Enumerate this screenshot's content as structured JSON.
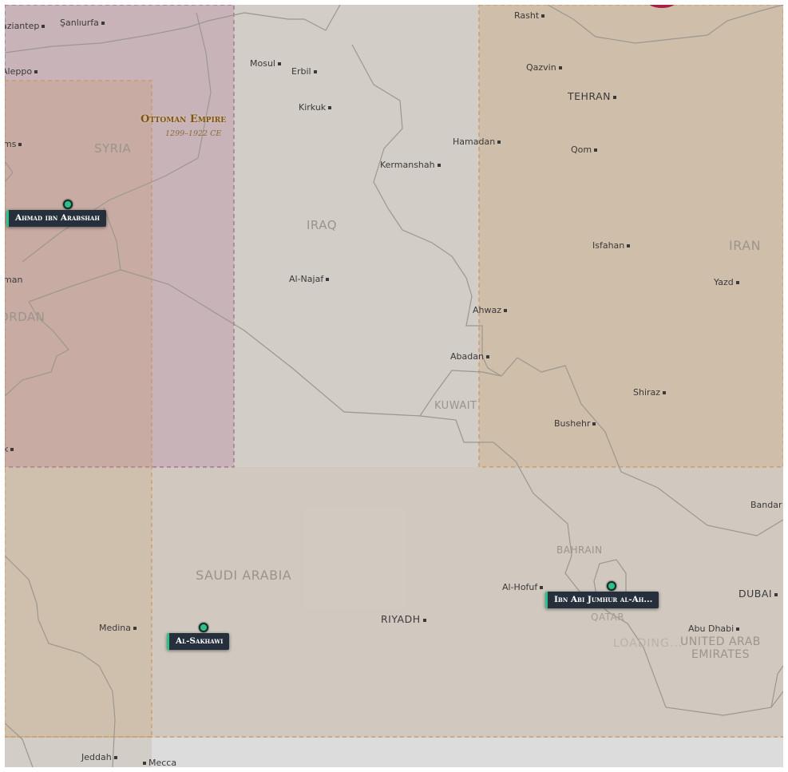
{
  "empires": [
    {
      "name": "Ottoman Empire",
      "dates": "1299–1922 CE",
      "color": "#b98fa8"
    },
    {
      "name": "",
      "color": "#c99a6a"
    }
  ],
  "countries": {
    "syria": "SYRIA",
    "iraq": "IRAQ",
    "iran": "IRAN",
    "jordan": "JORDAN",
    "kuwait": "KUWAIT",
    "saudi_arabia": "SAUDI ARABIA",
    "bahrain": "BAHRAIN",
    "qatar": "QATAR",
    "uae": "UNITED ARAB EMIRATES",
    "uae_line1": "UNITED ARAB",
    "uae_line2": "EMIRATES"
  },
  "cities": [
    "Gaziantep",
    "Şanlıurfa",
    "Aleppo",
    "Homs",
    "Amman",
    "Mosul",
    "Erbil",
    "Kirkuk",
    "Hamadan",
    "Kermanshah",
    "Al-Najaf",
    "Rasht",
    "Qazvin",
    "TEHRAN",
    "Qom",
    "Isfahan",
    "Yazd",
    "Ahwaz",
    "Abadan",
    "Shiraz",
    "Bushehr",
    "Bandar",
    "Al-Hofuf",
    "RIYADH",
    "DUBAI",
    "Abu Dhabi",
    "Medina",
    "Jeddah",
    "Mecca",
    "Tabuk"
  ],
  "city_labels": {
    "gaziantep": "aziantep",
    "sanliurfa": "Şanlıurfa",
    "aleppo": "Aleppo",
    "homs": "ms",
    "amman": "man",
    "mosul": "Mosul",
    "erbil": "Erbil",
    "kirkuk": "Kirkuk",
    "hamadan": "Hamadan",
    "kermanshah": "Kermanshah",
    "al_najaf": "Al-Najaf",
    "rasht": "Rasht",
    "qazvin": "Qazvin",
    "tehran": "TEHRAN",
    "qom": "Qom",
    "isfahan": "Isfahan",
    "yazd": "Yazd",
    "ahwaz": "Ahwaz",
    "abadan": "Abadan",
    "shiraz": "Shiraz",
    "bushehr": "Bushehr",
    "bandar": "Bandar",
    "al_hofuf": "Al-Hofuf",
    "riyadh": "RIYADH",
    "dubai": "DUBAI",
    "abu_dhabi": "Abu Dhabi",
    "medina": "Medina",
    "jeddah": "Jeddah",
    "mecca": "Mecca",
    "tabuk": "k",
    "jordan_partial": "JORDAN"
  },
  "people": [
    {
      "name": "Ahmad ibn Arabshah"
    },
    {
      "name": "Al-Sakhawi"
    },
    {
      "name": "Ibn Abi Jumhur al-Ah..."
    }
  ],
  "status": {
    "loading": "LOADING..."
  },
  "colors": {
    "marker": "#2fc08a",
    "label_bg": "#25303c",
    "land": "#d2cdc6",
    "border": "#9c978e"
  }
}
